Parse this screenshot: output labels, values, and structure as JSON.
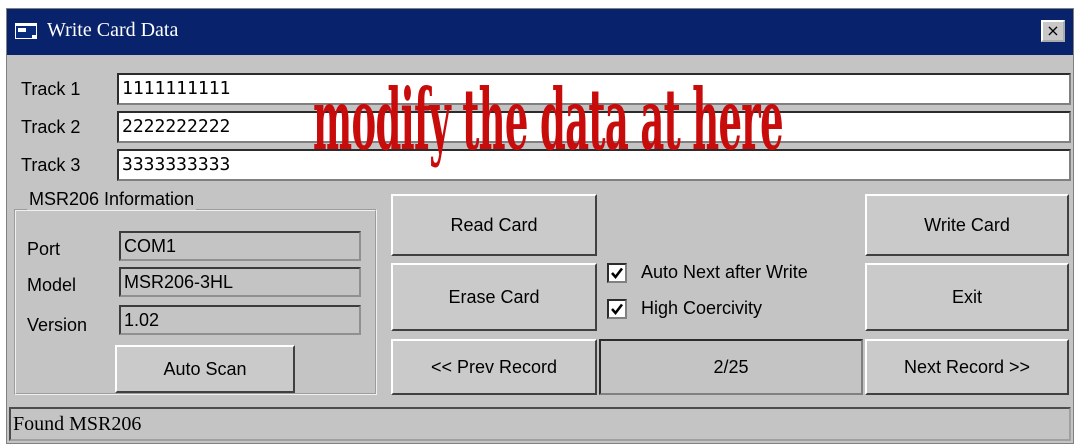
{
  "window": {
    "title": "Write Card Data",
    "close_label": "×"
  },
  "tracks": [
    {
      "label": "Track 1",
      "value": "1111111111"
    },
    {
      "label": "Track 2",
      "value": "2222222222"
    },
    {
      "label": "Track 3",
      "value": "3333333333"
    }
  ],
  "overlay": {
    "text": "modify the data at here",
    "color": "#c80c0c"
  },
  "info": {
    "title": "MSR206 Information",
    "port_label": "Port",
    "port_value": "COM1",
    "model_label": "Model",
    "model_value": "MSR206-3HL",
    "version_label": "Version",
    "version_value": "1.02",
    "auto_scan_label": "Auto Scan"
  },
  "buttons": {
    "read_card": "Read Card",
    "erase_card": "Erase Card",
    "prev_record": "<< Prev Record",
    "write_card": "Write Card",
    "exit": "Exit",
    "next_record": "Next Record >>"
  },
  "options": {
    "auto_next_label": "Auto Next after Write",
    "auto_next_checked": true,
    "high_coercivity_label": "High Coercivity",
    "high_coercivity_checked": true
  },
  "record_counter": "2/25",
  "status": "Found MSR206",
  "colors": {
    "titlebar": "#08226b",
    "window_bg": "#c4c4c4",
    "overlay_text": "#c80c0c"
  }
}
